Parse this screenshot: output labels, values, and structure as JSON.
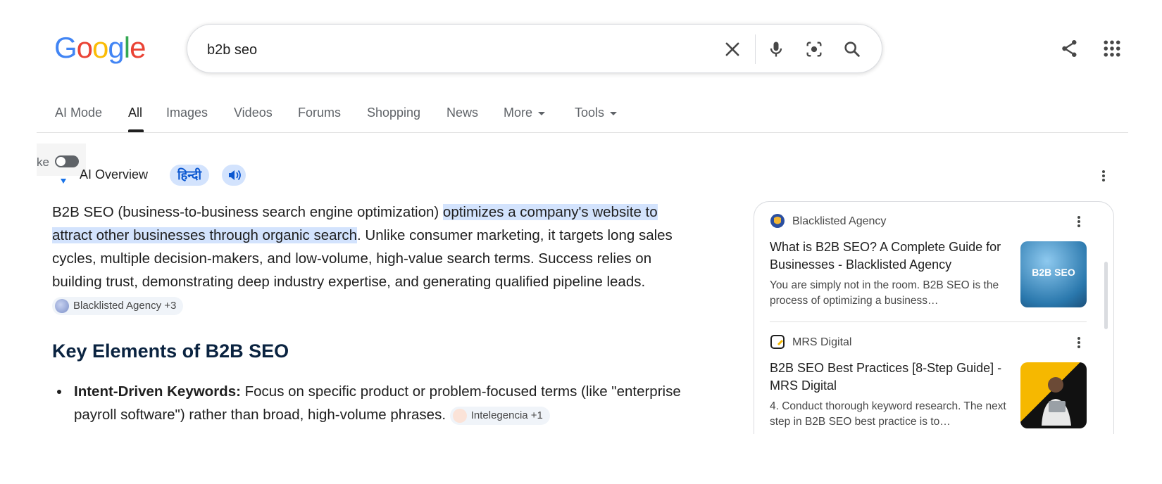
{
  "logo": {
    "letters": [
      "G",
      "o",
      "o",
      "g",
      "l",
      "e"
    ],
    "colors": [
      "#4285F4",
      "#EA4335",
      "#FBBC05",
      "#4285F4",
      "#34A853",
      "#EA4335"
    ]
  },
  "search": {
    "value": "b2b seo"
  },
  "tabs": [
    {
      "label": "AI Mode"
    },
    {
      "label": "All"
    },
    {
      "label": "Images"
    },
    {
      "label": "Videos"
    },
    {
      "label": "Forums"
    },
    {
      "label": "Shopping"
    },
    {
      "label": "News"
    },
    {
      "label": "More"
    },
    {
      "label": "Tools"
    }
  ],
  "toggle": {
    "text": "ke"
  },
  "ai_overview": {
    "label": "AI Overview",
    "lang_chip": "हिन्दी",
    "para": {
      "t1": "B2B SEO (business-to-business search engine optimization) ",
      "hl": "optimizes a company's website to attract other businesses through organic search",
      "t2": ". Unlike consumer marketing, it targets long sales cycles, multiple decision-makers, and low-volume, high-value search terms. Success relies on building trust, demonstrating deep industry expertise, and generating qualified pipeline leads. ",
      "cite": "Blacklisted Agency +3"
    },
    "heading": "Key Elements of B2B SEO",
    "bullet": {
      "bold": "Intent-Driven Keywords:",
      "text": " Focus on specific product or problem-focused terms (like \"enterprise payroll software\") rather than broad, high-volume phrases. ",
      "cite": "Intelegencia +1"
    }
  },
  "sources": [
    {
      "site": "Blacklisted Agency",
      "title": "What is B2B SEO? A Complete Guide for Businesses - Blacklisted Agency",
      "snippet": "You are simply not in the room. B2B SEO is the process of optimizing a business…",
      "thumb_text": "B2B SEO"
    },
    {
      "site": "MRS Digital",
      "title": "B2B SEO Best Practices [8-Step Guide] - MRS Digital",
      "snippet": "4. Conduct thorough keyword research. The next step in B2B SEO best practice is to…"
    }
  ]
}
